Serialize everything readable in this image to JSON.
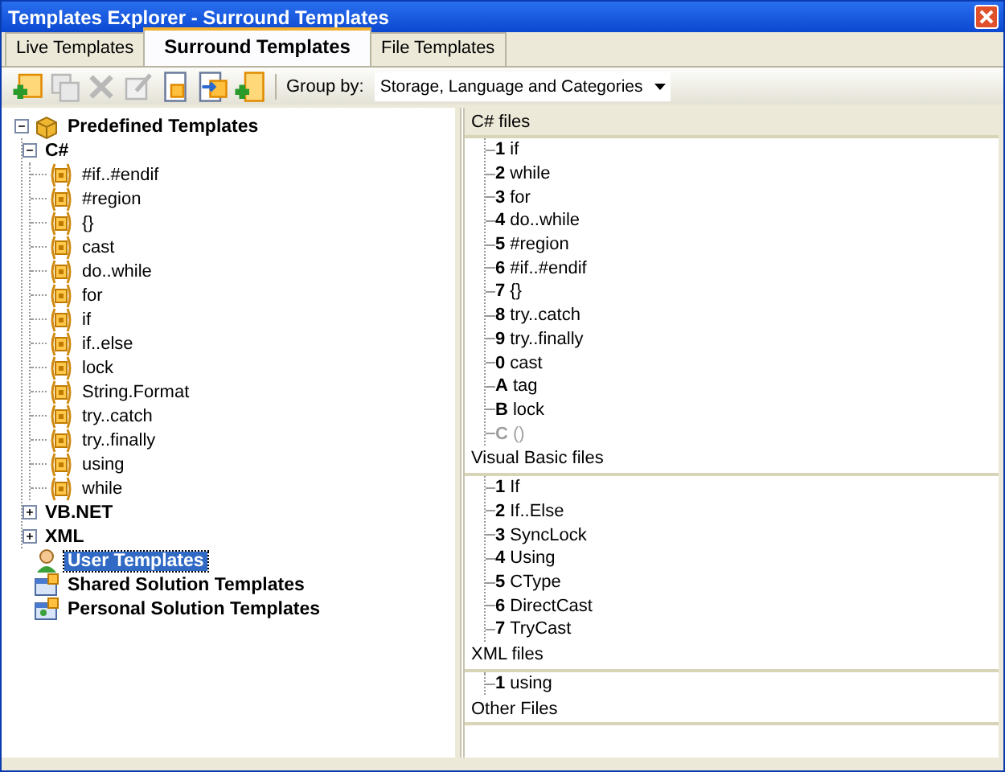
{
  "window": {
    "title": "Templates Explorer - Surround Templates"
  },
  "tabs": [
    {
      "label": "Live Templates",
      "selected": false
    },
    {
      "label": "Surround Templates",
      "selected": true
    },
    {
      "label": "File Templates",
      "selected": false
    }
  ],
  "toolbar": {
    "buttons": [
      {
        "kind": "new",
        "disabled": false
      },
      {
        "kind": "copy",
        "disabled": true
      },
      {
        "kind": "delete",
        "disabled": true
      },
      {
        "kind": "edit",
        "disabled": true
      },
      {
        "kind": "page",
        "disabled": false
      },
      {
        "kind": "import",
        "disabled": false
      },
      {
        "kind": "add-list",
        "disabled": false
      }
    ],
    "group_by_label": "Group by:",
    "group_by_value": "Storage, Language and Categories"
  },
  "tree": [
    {
      "label": "Predefined Templates",
      "kind": "package",
      "expanded": true,
      "selected": false,
      "children": [
        {
          "label": "C#",
          "kind": "language",
          "expanded": true,
          "selected": false,
          "children": [
            {
              "label": "#if..#endif",
              "kind": "template",
              "selected": false
            },
            {
              "label": "#region",
              "kind": "template",
              "selected": false
            },
            {
              "label": "{}",
              "kind": "template",
              "selected": false
            },
            {
              "label": "cast",
              "kind": "template",
              "selected": false
            },
            {
              "label": "do..while",
              "kind": "template",
              "selected": false
            },
            {
              "label": "for",
              "kind": "template",
              "selected": false
            },
            {
              "label": "if",
              "kind": "template",
              "selected": false
            },
            {
              "label": "if..else",
              "kind": "template",
              "selected": false
            },
            {
              "label": "lock",
              "kind": "template",
              "selected": false
            },
            {
              "label": "String.Format",
              "kind": "template",
              "selected": false
            },
            {
              "label": "try..catch",
              "kind": "template",
              "selected": false
            },
            {
              "label": "try..finally",
              "kind": "template",
              "selected": false
            },
            {
              "label": "using",
              "kind": "template",
              "selected": false
            },
            {
              "label": "while",
              "kind": "template",
              "selected": false
            }
          ]
        },
        {
          "label": "VB.NET",
          "kind": "language",
          "expanded": false,
          "selected": false
        },
        {
          "label": "XML",
          "kind": "language",
          "expanded": false,
          "selected": false
        }
      ]
    },
    {
      "label": "User Templates",
      "kind": "user",
      "selected": true
    },
    {
      "label": "Shared Solution Templates",
      "kind": "solution",
      "selected": false
    },
    {
      "label": "Personal Solution Templates",
      "kind": "personal-solution",
      "selected": false
    }
  ],
  "groups": [
    {
      "title": "C# files",
      "items": [
        {
          "key": "1",
          "label": "if",
          "disabled": false
        },
        {
          "key": "2",
          "label": "while",
          "disabled": false
        },
        {
          "key": "3",
          "label": "for",
          "disabled": false
        },
        {
          "key": "4",
          "label": "do..while",
          "disabled": false
        },
        {
          "key": "5",
          "label": "#region",
          "disabled": false
        },
        {
          "key": "6",
          "label": "#if..#endif",
          "disabled": false
        },
        {
          "key": "7",
          "label": "{}",
          "disabled": false
        },
        {
          "key": "8",
          "label": "try..catch",
          "disabled": false
        },
        {
          "key": "9",
          "label": "try..finally",
          "disabled": false
        },
        {
          "key": "0",
          "label": "cast",
          "disabled": false
        },
        {
          "key": "A",
          "label": "tag",
          "disabled": false
        },
        {
          "key": "B",
          "label": "lock",
          "disabled": false
        },
        {
          "key": "C",
          "label": "()",
          "disabled": true
        }
      ]
    },
    {
      "title": "Visual Basic files",
      "items": [
        {
          "key": "1",
          "label": "If",
          "disabled": false
        },
        {
          "key": "2",
          "label": "If..Else",
          "disabled": false
        },
        {
          "key": "3",
          "label": "SyncLock",
          "disabled": false
        },
        {
          "key": "4",
          "label": "Using",
          "disabled": false
        },
        {
          "key": "5",
          "label": "CType",
          "disabled": false
        },
        {
          "key": "6",
          "label": "DirectCast",
          "disabled": false
        },
        {
          "key": "7",
          "label": "TryCast",
          "disabled": false
        }
      ]
    },
    {
      "title": "XML files",
      "items": [
        {
          "key": "1",
          "label": "using",
          "disabled": false
        }
      ]
    },
    {
      "title": "Other Files"
    }
  ]
}
